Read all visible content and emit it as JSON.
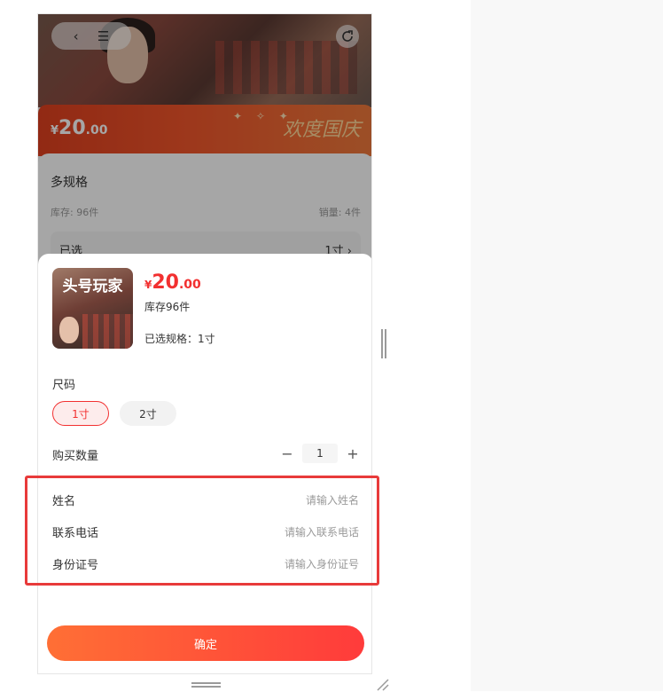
{
  "nav": {
    "back_icon": "‹",
    "menu_icon": "☰",
    "share_icon": "⟳"
  },
  "banner": {
    "currency": "¥",
    "price_int": "20",
    "price_dec": ".00",
    "festival_text": "欢度国庆"
  },
  "info": {
    "title": "多规格",
    "stock": "库存: 96件",
    "sales": "销量: 4件",
    "selected_label": "已选",
    "selected_value": "1寸 ›"
  },
  "sheet": {
    "thumb_logo": "头号玩家",
    "currency": "¥",
    "price_int": "20",
    "price_dec": ".00",
    "stock": "库存96件",
    "chosen_spec": "已选规格：1寸",
    "spec_title": "尺码",
    "options": [
      "1寸",
      "2寸"
    ],
    "qty_label": "购买数量",
    "qty_minus": "−",
    "qty_value": "1",
    "qty_plus": "+",
    "form": [
      {
        "label": "姓名",
        "placeholder": "请输入姓名"
      },
      {
        "label": "联系电话",
        "placeholder": "请输入联系电话"
      },
      {
        "label": "身份证号",
        "placeholder": "请输入身份证号"
      }
    ],
    "confirm_label": "确定"
  },
  "colors": {
    "accent": "#f23030",
    "highlight_border": "#e83a3a",
    "button_from": "#ff6f35",
    "button_to": "#ff3b3b"
  }
}
